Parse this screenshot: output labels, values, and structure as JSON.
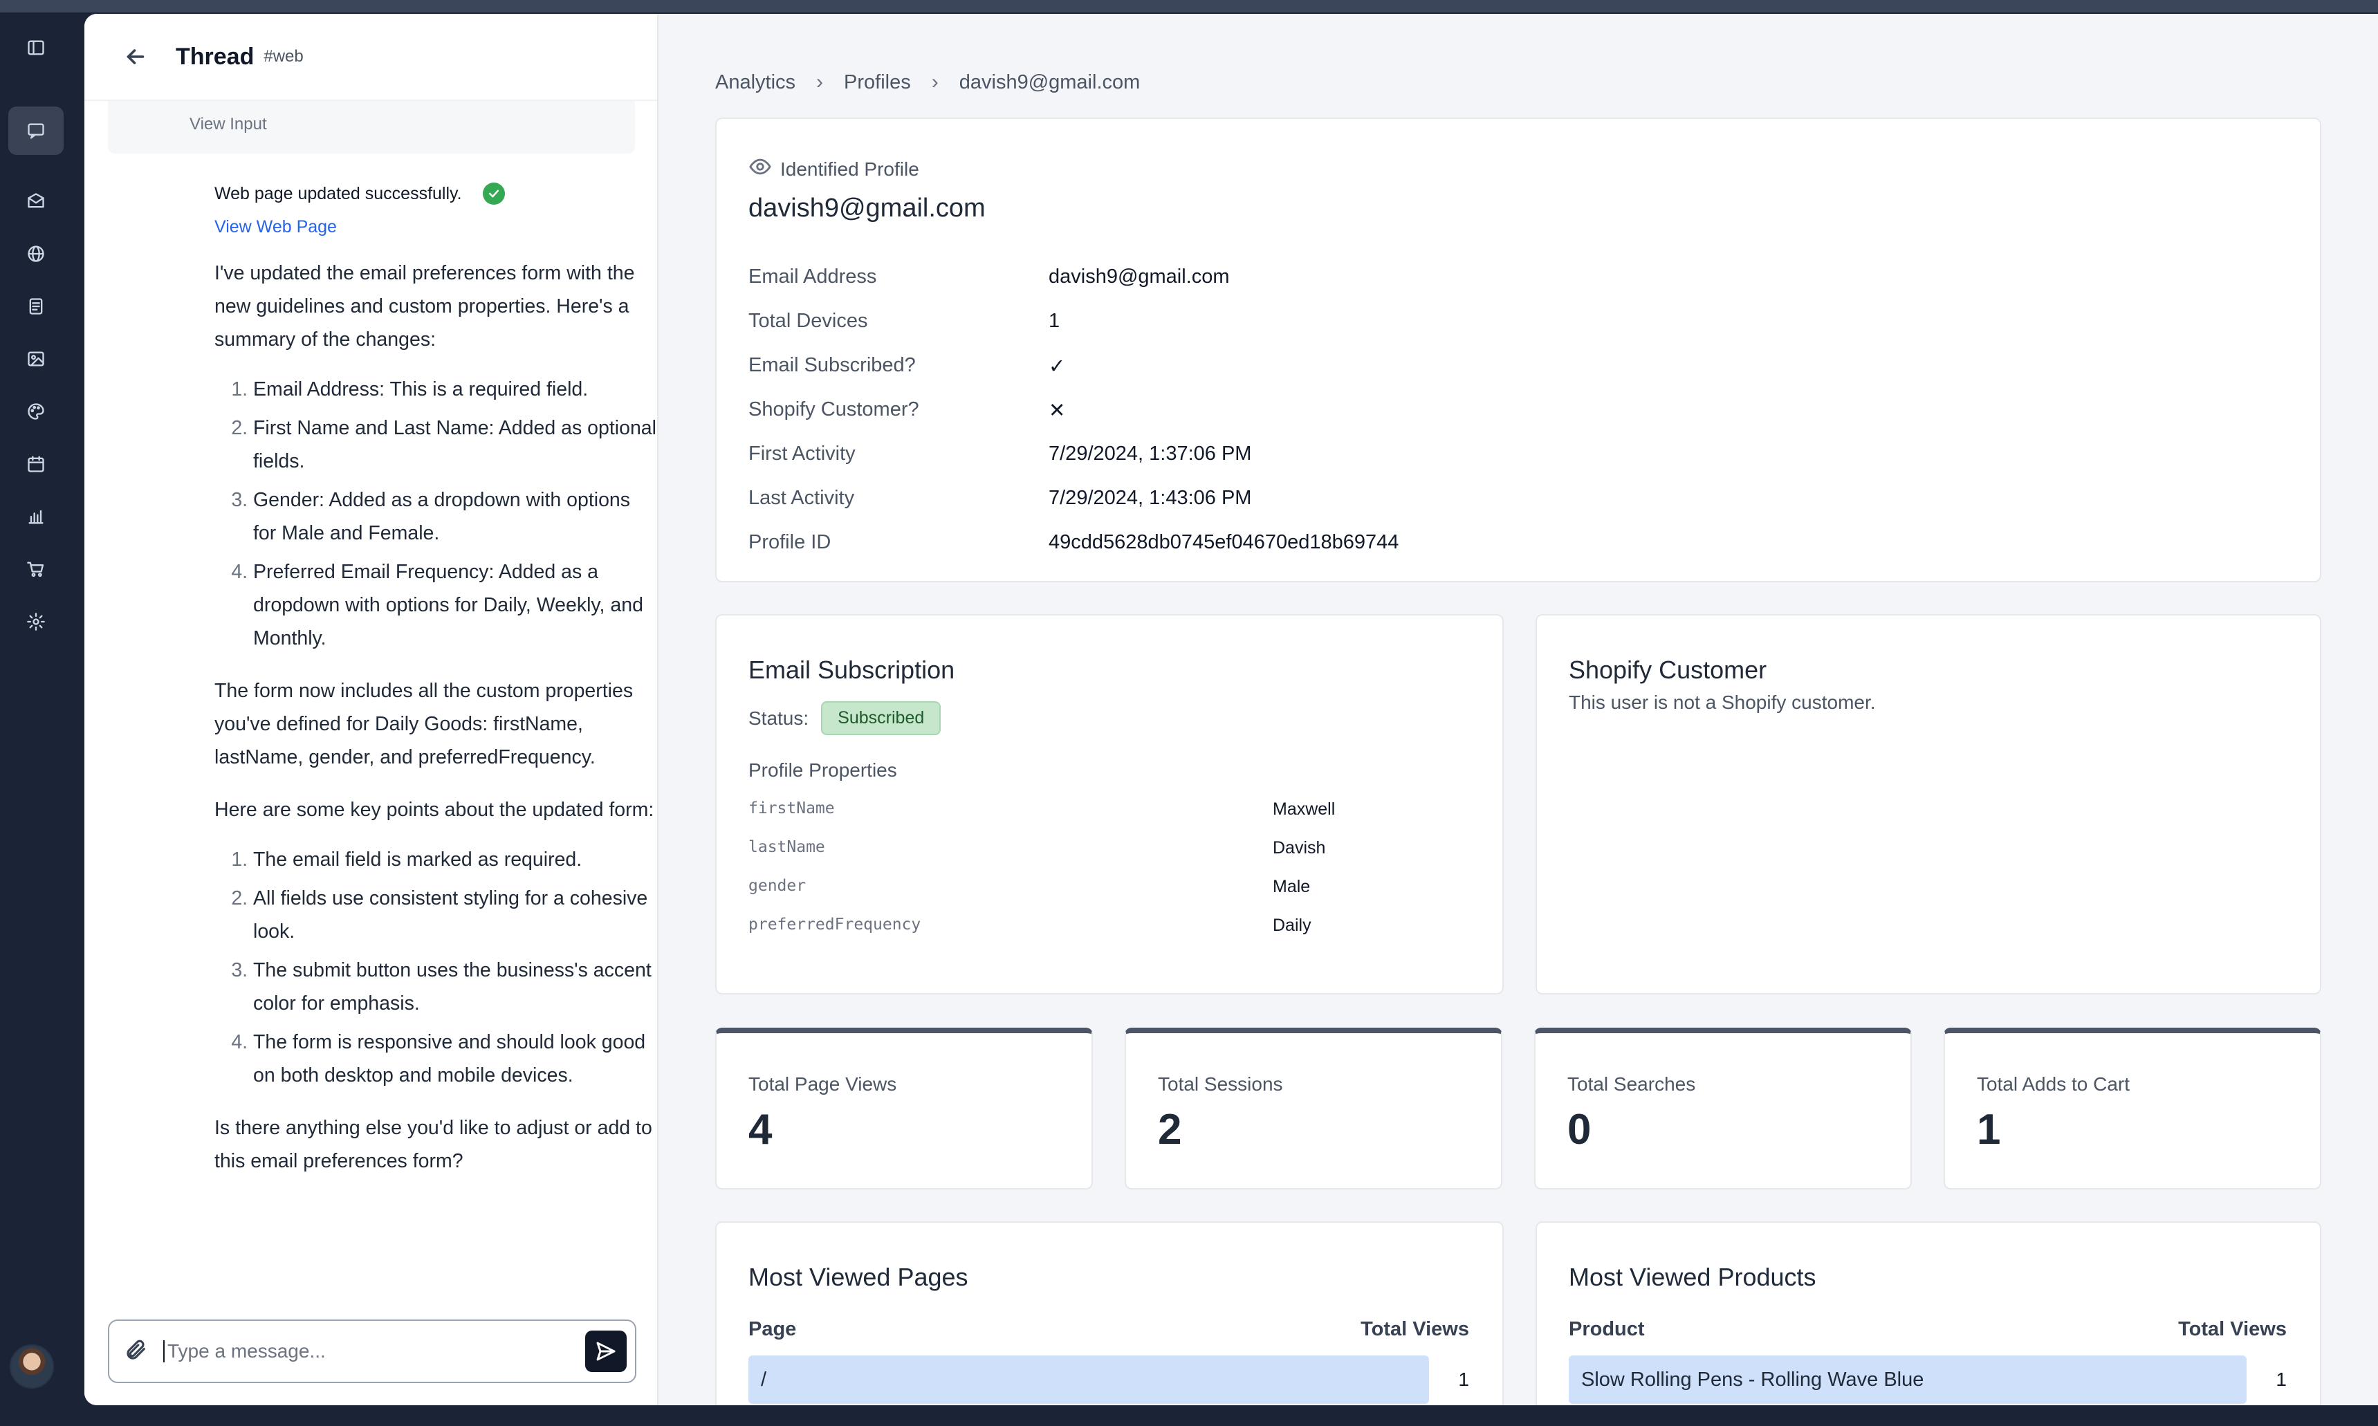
{
  "rail": {
    "items": [
      "sidebar-toggle",
      "chat",
      "mail",
      "globe",
      "document",
      "image",
      "palette",
      "calendar",
      "bar-chart",
      "cart",
      "settings"
    ]
  },
  "thread": {
    "title": "Thread",
    "tag": "#web",
    "view_input": "View Input",
    "status": "Web page updated successfully.",
    "view_link": "View Web Page",
    "intro": "I've updated the email preferences form with the new guidelines and custom properties. Here's a summary of the changes:",
    "changes": [
      "Email Address: This is a required field.",
      "First Name and Last Name: Added as optional fields.",
      "Gender: Added as a dropdown with options for Male and Female.",
      "Preferred Email Frequency: Added as a dropdown with options for Daily, Weekly, and Monthly."
    ],
    "para2": "The form now includes all the custom properties you've defined for Daily Goods: firstName, lastName, gender, and preferredFrequency.",
    "para3": "Here are some key points about the updated form:",
    "points": [
      "The email field is marked as required.",
      "All fields use consistent styling for a cohesive look.",
      "The submit button uses the business's accent color for emphasis.",
      "The form is responsive and should look good on both desktop and mobile devices."
    ],
    "closing": "Is there anything else you'd like to adjust or add to this email preferences form?",
    "composer_placeholder": "Type a message..."
  },
  "breadcrumb": [
    "Analytics",
    "Profiles",
    "davish9@gmail.com"
  ],
  "profile": {
    "kicker": "Identified Profile",
    "email": "davish9@gmail.com",
    "rows": [
      {
        "label": "Email Address",
        "value": "davish9@gmail.com"
      },
      {
        "label": "Total Devices",
        "value": "1"
      },
      {
        "label": "Email Subscribed?",
        "value": "✓"
      },
      {
        "label": "Shopify Customer?",
        "value": "✕"
      },
      {
        "label": "First Activity",
        "value": "7/29/2024, 1:37:06 PM"
      },
      {
        "label": "Last Activity",
        "value": "7/29/2024, 1:43:06 PM"
      },
      {
        "label": "Profile ID",
        "value": "49cdd5628db0745ef04670ed18b69744"
      }
    ]
  },
  "subscription": {
    "title": "Email Subscription",
    "status_label": "Status:",
    "status_value": "Subscribed",
    "status_color": "#c6e7cc",
    "properties_heading": "Profile Properties",
    "properties": [
      {
        "key": "firstName",
        "value": "Maxwell"
      },
      {
        "key": "lastName",
        "value": "Davish"
      },
      {
        "key": "gender",
        "value": "Male"
      },
      {
        "key": "preferredFrequency",
        "value": "Daily"
      }
    ]
  },
  "shopify": {
    "title": "Shopify Customer",
    "note": "This user is not a Shopify customer."
  },
  "stats": [
    {
      "label": "Total Page Views",
      "value": "4"
    },
    {
      "label": "Total Sessions",
      "value": "2"
    },
    {
      "label": "Total Searches",
      "value": "0"
    },
    {
      "label": "Total Adds to Cart",
      "value": "1"
    }
  ],
  "pages": {
    "title": "Most Viewed Pages",
    "col1": "Page",
    "col2": "Total Views",
    "rows": [
      {
        "name": "/",
        "views": "1"
      }
    ]
  },
  "products": {
    "title": "Most Viewed Products",
    "col1": "Product",
    "col2": "Total Views",
    "rows": [
      {
        "name": "Slow Rolling Pens - Rolling Wave Blue",
        "views": "1"
      }
    ]
  },
  "colors": {
    "accent_link": "#2563eb",
    "bar": "#cfe0fb",
    "rail": "#1b2436"
  }
}
